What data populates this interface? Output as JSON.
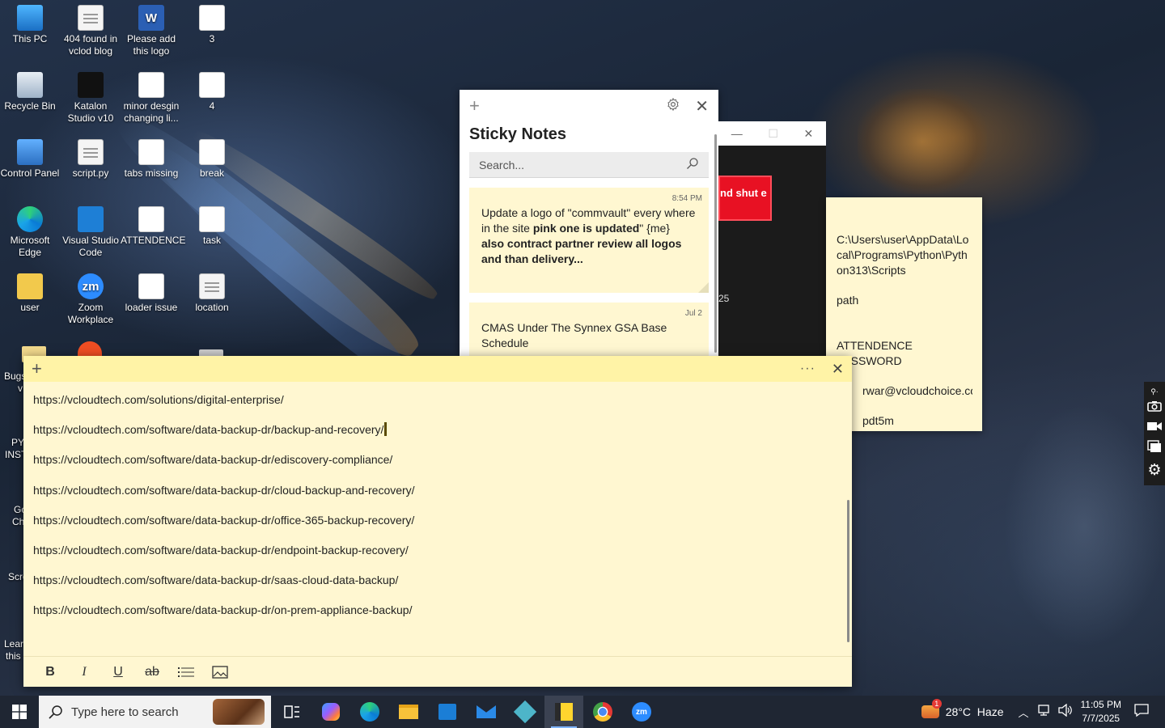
{
  "desktop": {
    "icons": [
      {
        "label": "This PC",
        "icon": "this-pc-icon"
      },
      {
        "label": "404 found in vclod blog",
        "icon": "document-icon"
      },
      {
        "label": "Please add this logo",
        "icon": "word-document-icon"
      },
      {
        "label": "3",
        "icon": "image-file-icon"
      },
      {
        "label": "Recycle Bin",
        "icon": "recycle-bin-icon"
      },
      {
        "label": "Katalon Studio v10",
        "icon": "katalon-icon"
      },
      {
        "label": "minor desgin changing li...",
        "icon": "image-file-icon"
      },
      {
        "label": "4",
        "icon": "image-file-icon"
      },
      {
        "label": "Control Panel",
        "icon": "control-panel-icon"
      },
      {
        "label": "script.py",
        "icon": "document-icon"
      },
      {
        "label": "tabs missing",
        "icon": "image-file-icon"
      },
      {
        "label": "break",
        "icon": "image-file-icon"
      },
      {
        "label": "Microsoft Edge",
        "icon": "edge-icon"
      },
      {
        "label": "Visual Studio Code",
        "icon": "vscode-icon"
      },
      {
        "label": "ATTENDENCE",
        "icon": "image-file-icon"
      },
      {
        "label": "task",
        "icon": "image-file-icon"
      },
      {
        "label": "user",
        "icon": "user-folder-icon"
      },
      {
        "label": "Zoom Workplace",
        "icon": "zoom-icon"
      },
      {
        "label": "loader issue",
        "icon": "image-file-icon"
      },
      {
        "label": "location",
        "icon": "document-icon"
      }
    ],
    "partial_labels": [
      "Bugs",
      "v",
      "PY",
      "INST",
      "Go",
      "Ch",
      "Scre",
      "Lear",
      "this"
    ]
  },
  "sticky_list": {
    "title": "Sticky Notes",
    "search_placeholder": "Search...",
    "notes": [
      {
        "date": "8:54 PM",
        "line1": "Update a logo of \"commvault\" every where in the site ",
        "bold1": "pink one is updated",
        "line2": "\" {me}",
        "bold2": "also contract partner review all logos and than delivery..."
      },
      {
        "date": "Jul 2",
        "text": "CMAS Under The Synnex GSA Base Schedule"
      }
    ]
  },
  "black_window": {
    "button_text": "nd shut e",
    "side_text": "25"
  },
  "right_note": {
    "lines": [
      "C:\\Users\\user\\AppData\\Local\\Programs\\Python\\Python313\\Scripts",
      "path",
      "ATTENDENCE PASSWORD",
      "rwar@vcloudchoice.co",
      "pdt5m"
    ]
  },
  "main_note": {
    "lines": [
      "https://vcloudtech.com/solutions/digital-enterprise/",
      "https://vcloudtech.com/software/data-backup-dr/backup-and-recovery/",
      "https://vcloudtech.com/software/data-backup-dr/ediscovery-compliance/",
      "https://vcloudtech.com/software/data-backup-dr/cloud-backup-and-recovery/",
      "https://vcloudtech.com/software/data-backup-dr/office-365-backup-recovery/",
      "https://vcloudtech.com/software/data-backup-dr/endpoint-backup-recovery/",
      "https://vcloudtech.com/software/data-backup-dr/saas-cloud-data-backup/",
      "https://vcloudtech.com/software/data-backup-dr/on-prem-appliance-backup/"
    ],
    "toolbar": {
      "bold": "B",
      "italic": "I",
      "underline": "U",
      "strike": "ab"
    }
  },
  "taskbar": {
    "search_placeholder": "Type here to search",
    "weather": "28°C  Haze",
    "weather_badge": "1",
    "time": "11:05 PM",
    "date": "7/7/2025"
  }
}
